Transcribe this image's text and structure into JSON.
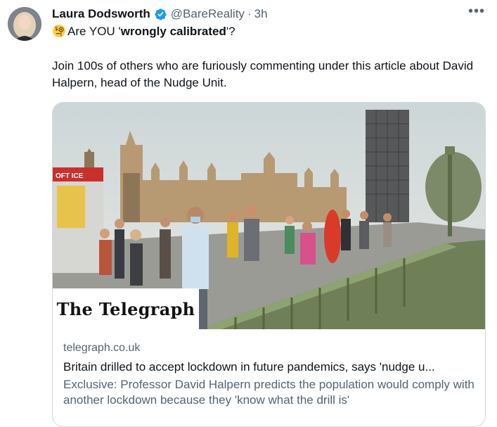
{
  "author": {
    "name": "Laura Dodsworth",
    "handle": "@BareReality",
    "separator": "·",
    "time": "3h",
    "verified": true
  },
  "tweet": {
    "emoji": "face-with-monocle",
    "line1_prefix": "Are YOU '",
    "line1_bold": "wrongly calibrated",
    "line1_suffix": "'?",
    "paragraph2": "Join 100s of others who are furiously commenting under this article about David Halpern, head of the Nudge Unit."
  },
  "card": {
    "masthead": "The Telegraph",
    "sign_text": "OFT ICE",
    "domain": "telegraph.co.uk",
    "headline": "Britain drilled to accept lockdown in future pandemics, says 'nudge u...",
    "description": "Exclusive: Professor David Halpern predicts the population would comply with another lockdown because they 'know what the drill is'"
  },
  "colors": {
    "verified_badge": "#1d9bf0",
    "secondary_text": "#536471",
    "card_border": "#cfd9de"
  }
}
